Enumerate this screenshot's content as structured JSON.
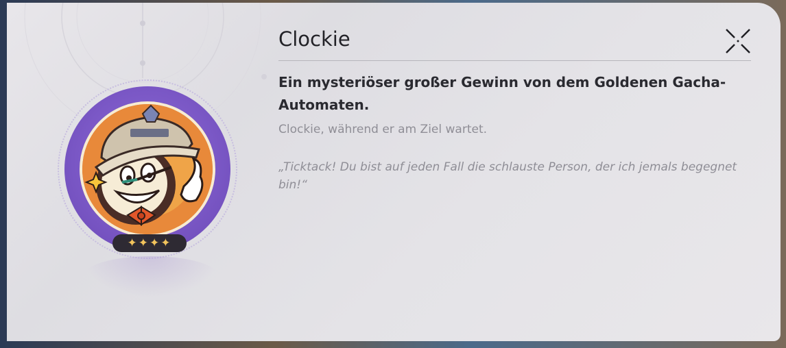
{
  "card": {
    "name": "Clockie",
    "subtitle": "Ein mysteriöser großer Gewinn von dem Goldenen Gacha-Automaten.",
    "description": "Clockie, während er am Ziel wartet.",
    "quote": "„Ticktack! Du bist auf jeden Fall die schlauste Person, der ich jemals begegnet bin!“",
    "rarity_stars": "✦✦✦✦",
    "rarity_count": 4
  },
  "icons": {
    "close": "close-icon",
    "portrait": "clockie-portrait"
  },
  "colors": {
    "panel": "#e6e5e9",
    "accent_purple": "#7b58c6",
    "star_gold": "#f2c35c",
    "title_text": "#222227",
    "muted_text": "#8f8e96"
  }
}
